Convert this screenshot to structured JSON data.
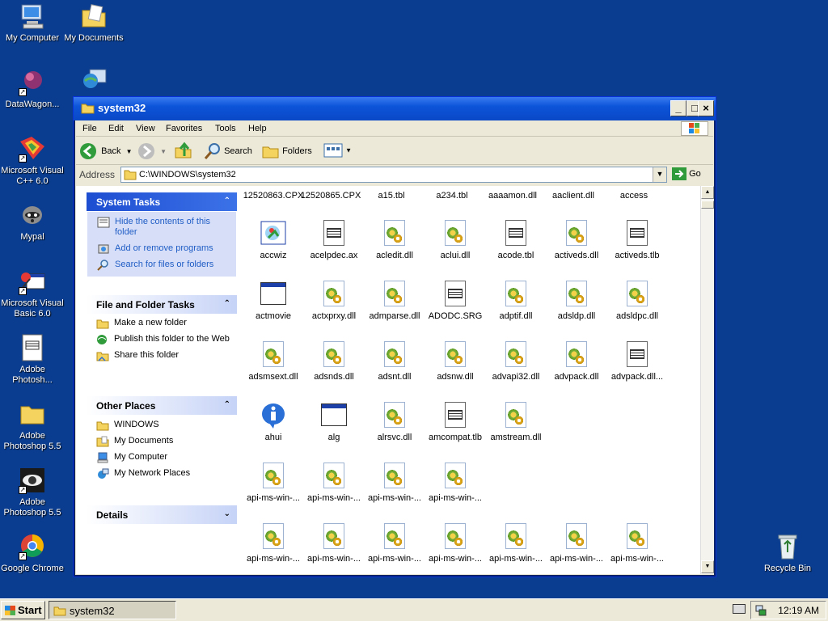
{
  "desktop": {
    "icons": [
      {
        "label": "My Computer",
        "icon": "computer-icon"
      },
      {
        "label": "My Documents",
        "icon": "documents-folder-icon"
      },
      {
        "label": "DataWagon...",
        "icon": "datawagon-icon"
      },
      {
        "label": "",
        "icon": "network-globe-icon"
      },
      {
        "label": "Microsoft Visual C++ 6.0",
        "icon": "visual-cpp-icon"
      },
      {
        "label": "Mypal",
        "icon": "mypal-raccoon-icon"
      },
      {
        "label": "Microsoft Visual Basic 6.0",
        "icon": "visual-basic-icon"
      },
      {
        "label": "Adobe Photosh...",
        "icon": "photoshop-file-icon"
      },
      {
        "label": "Adobe Photoshop 5.5",
        "icon": "folder-icon"
      },
      {
        "label": "Adobe Photoshop 5.5",
        "icon": "photoshop-eye-icon"
      },
      {
        "label": "Google Chrome",
        "icon": "chrome-icon"
      },
      {
        "label": "Recycle Bin",
        "icon": "recycle-bin-icon"
      }
    ]
  },
  "window": {
    "title": "system32",
    "menu": [
      "File",
      "Edit",
      "View",
      "Favorites",
      "Tools",
      "Help"
    ],
    "toolbar": {
      "back": "Back",
      "search": "Search",
      "folders": "Folders"
    },
    "address": {
      "label": "Address",
      "value": "C:\\WINDOWS\\system32",
      "go": "Go"
    }
  },
  "taskpane": {
    "system_tasks": {
      "title": "System Tasks",
      "items": [
        "Hide the contents of this folder",
        "Add or remove programs",
        "Search for files or folders"
      ]
    },
    "file_tasks": {
      "title": "File and Folder Tasks",
      "items": [
        "Make a new folder",
        "Publish this folder to the Web",
        "Share this folder"
      ]
    },
    "other_places": {
      "title": "Other Places",
      "items": [
        "WINDOWS",
        "My Documents",
        "My Computer",
        "My Network Places"
      ]
    },
    "details": {
      "title": "Details"
    }
  },
  "files": {
    "row0": [
      "12520863.CPX",
      "12520865.CPX",
      "a15.tbl",
      "a234.tbl",
      "aaaamon.dll",
      "aaclient.dll",
      "access"
    ],
    "row1": [
      {
        "name": "accwiz",
        "type": "app"
      },
      {
        "name": "acelpdec.ax",
        "type": "doc"
      },
      {
        "name": "acledit.dll",
        "type": "dll"
      },
      {
        "name": "aclui.dll",
        "type": "dll"
      },
      {
        "name": "acode.tbl",
        "type": "doc"
      },
      {
        "name": "activeds.dll",
        "type": "dll"
      },
      {
        "name": "activeds.tlb",
        "type": "doc"
      }
    ],
    "row2": [
      {
        "name": "actmovie",
        "type": "exe"
      },
      {
        "name": "actxprxy.dll",
        "type": "dll"
      },
      {
        "name": "admparse.dll",
        "type": "dll"
      },
      {
        "name": "ADODC.SRG",
        "type": "doc"
      },
      {
        "name": "adptif.dll",
        "type": "dll"
      },
      {
        "name": "adsldp.dll",
        "type": "dll"
      },
      {
        "name": "adsldpc.dll",
        "type": "dll"
      }
    ],
    "row3": [
      {
        "name": "adsmsext.dll",
        "type": "dll"
      },
      {
        "name": "adsnds.dll",
        "type": "dll"
      },
      {
        "name": "adsnt.dll",
        "type": "dll"
      },
      {
        "name": "adsnw.dll",
        "type": "dll"
      },
      {
        "name": "advapi32.dll",
        "type": "dll"
      },
      {
        "name": "advpack.dll",
        "type": "dll"
      },
      {
        "name": "advpack.dll...",
        "type": "doc"
      }
    ],
    "row4": [
      {
        "name": "ahui",
        "type": "info"
      },
      {
        "name": "alg",
        "type": "exe"
      },
      {
        "name": "alrsvc.dll",
        "type": "dll"
      },
      {
        "name": "amcompat.tlb",
        "type": "doc"
      },
      {
        "name": "amstream.dll",
        "type": "dll"
      }
    ],
    "row5": [
      {
        "name": "api-ms-win-...",
        "type": "dll"
      },
      {
        "name": "api-ms-win-...",
        "type": "dll"
      },
      {
        "name": "api-ms-win-...",
        "type": "dll"
      },
      {
        "name": "api-ms-win-...",
        "type": "dll"
      }
    ],
    "row6": [
      {
        "name": "api-ms-win-...",
        "type": "dll"
      },
      {
        "name": "api-ms-win-...",
        "type": "dll"
      },
      {
        "name": "api-ms-win-...",
        "type": "dll"
      },
      {
        "name": "api-ms-win-...",
        "type": "dll"
      },
      {
        "name": "api-ms-win-...",
        "type": "dll"
      },
      {
        "name": "api-ms-win-...",
        "type": "dll"
      },
      {
        "name": "api-ms-win-...",
        "type": "dll"
      }
    ]
  },
  "taskbar": {
    "start": "Start",
    "app": "system32",
    "clock": "12:19 AM"
  }
}
